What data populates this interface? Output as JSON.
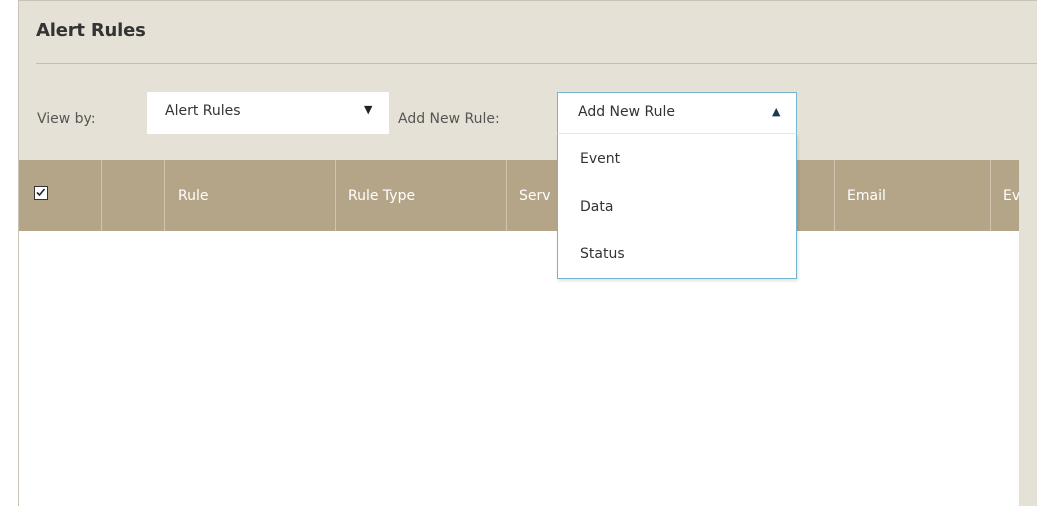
{
  "page": {
    "title": "Alert Rules"
  },
  "toolbar": {
    "view_by_label": "View by:",
    "view_by_value": "Alert Rules",
    "add_new_rule_label": "Add New Rule:",
    "add_new_rule_value": "Add New Rule"
  },
  "dropdown": {
    "options": [
      "Event",
      "Data",
      "Status"
    ]
  },
  "table": {
    "columns": [
      "",
      "Rule",
      "Rule Type",
      "Serv",
      "Email",
      "Eve"
    ]
  },
  "colors": {
    "panel_bg": "#e5e1d6",
    "header_bg": "#b5a588",
    "dropdown_border": "#73b6cd"
  },
  "icons": {
    "view_by_arrow": "triangle-down-icon",
    "add_rule_arrow": "triangle-up-icon",
    "select_all": "checkbox-checked-icon"
  }
}
